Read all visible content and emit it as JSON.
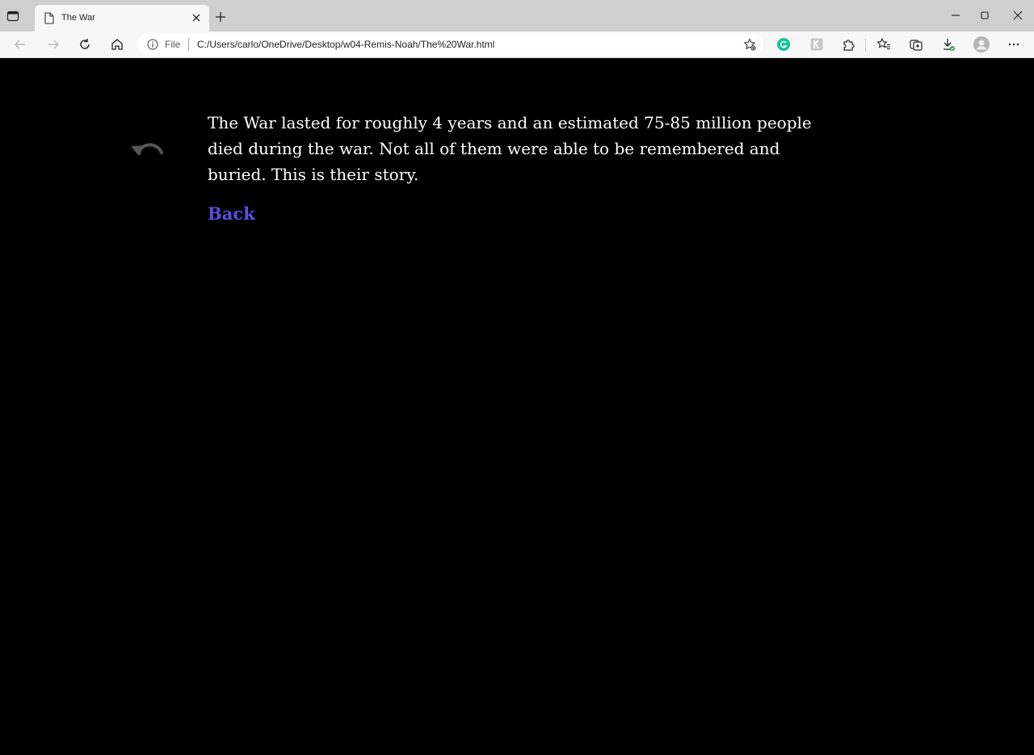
{
  "tab": {
    "title": "The War"
  },
  "address": {
    "scheme_label": "File",
    "url": "C:/Users/carlo/OneDrive/Desktop/w04-Remis-Noah/The%20War.html"
  },
  "page": {
    "story": "The War lasted for roughly 4 years and an estimated 75-85 million people died during the war. Not all of them were able to be remembered and buried. This is their story.",
    "back_label": "Back"
  },
  "colors": {
    "link": "#5a4fe0",
    "background": "#000000",
    "text": "#ffffff",
    "grammarly": "#15c39a"
  }
}
